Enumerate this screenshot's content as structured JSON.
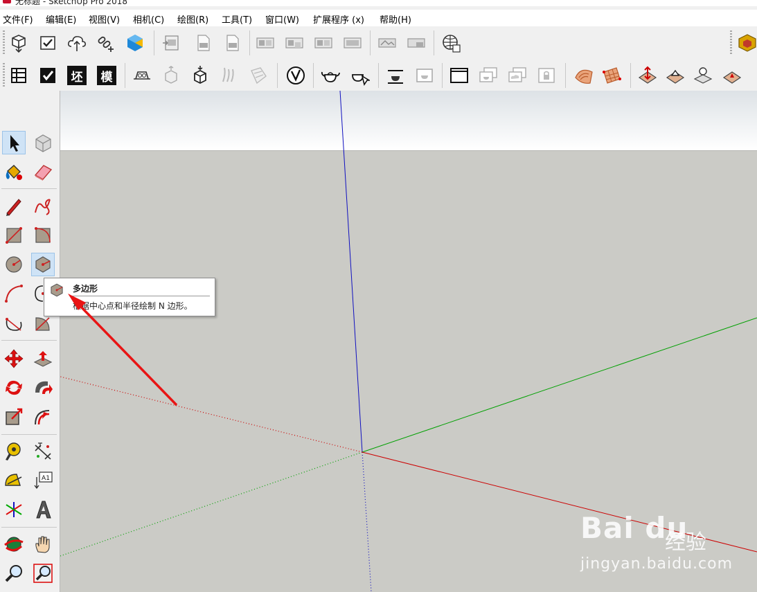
{
  "window": {
    "title": "无标题 - SketchUp Pro 2018"
  },
  "menu": [
    {
      "label": "文件(F)"
    },
    {
      "label": "编辑(E)"
    },
    {
      "label": "视图(V)"
    },
    {
      "label": "相机(C)"
    },
    {
      "label": "绘图(R)"
    },
    {
      "label": "工具(T)"
    },
    {
      "label": "窗口(W)"
    },
    {
      "label": "扩展程序 (x)"
    },
    {
      "label": "帮助(H)"
    }
  ],
  "toolbar2": {
    "text_buttons": [
      "坯",
      "模"
    ]
  },
  "left_toolbar": {
    "text_label_tool": "A1"
  },
  "tooltip": {
    "title": "多边形",
    "description": "根据中心点和半径绘制 N 边形。"
  },
  "watermark": {
    "logo": "Bai du",
    "cn": "经验",
    "url": "jingyan.baidu.com"
  },
  "colors": {
    "red_axis": "#cc0000",
    "green_axis": "#00a000",
    "blue_axis": "#1010c0",
    "annotation_arrow": "#e81414",
    "ground": "#cbcbc6"
  }
}
